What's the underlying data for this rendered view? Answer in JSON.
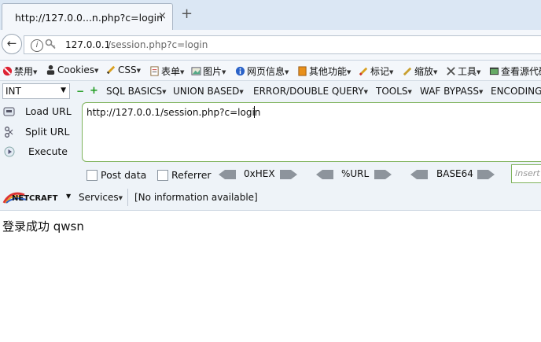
{
  "tab": {
    "title": "http://127.0.0...n.php?c=login",
    "close_glyph": "×",
    "new_tab_glyph": "+"
  },
  "navbar": {
    "url_host": "127.0.0.1",
    "url_path": "/session.php?c=login"
  },
  "toolbar": {
    "items": [
      {
        "label": "禁用",
        "icon": "no-entry-icon"
      },
      {
        "label": "Cookies",
        "icon": "cookie-person-icon"
      },
      {
        "label": "CSS",
        "icon": "pencil-icon"
      },
      {
        "label": "表单",
        "icon": "form-icon"
      },
      {
        "label": "图片",
        "icon": "image-icon"
      },
      {
        "label": "网页信息",
        "icon": "info-icon"
      },
      {
        "label": "其他功能",
        "icon": "orange-box-icon"
      },
      {
        "label": "标记",
        "icon": "highlighter-icon"
      },
      {
        "label": "缩放",
        "icon": "resize-icon"
      },
      {
        "label": "工具",
        "icon": "wrench-icon"
      },
      {
        "label": "查看源代码",
        "icon": "source-icon"
      }
    ]
  },
  "hackbar": {
    "select_value": "INT",
    "menus": [
      "SQL BASICS",
      "UNION BASED",
      "ERROR/DOUBLE QUERY",
      "TOOLS",
      "WAF BYPASS",
      "ENCODING"
    ],
    "load_url": "Load URL",
    "split_url": "Split URL",
    "execute": "Execute",
    "url_text": "http://127.0.0.1/session.php?c=login",
    "post_data": "Post data",
    "referrer": "Referrer",
    "hex": "0xHEX",
    "url_enc": "%URL",
    "base64": "BASE64",
    "insert_placeholder": "Insert",
    "netcraft": "NETCRAFT",
    "services": "Services",
    "info": "[No information available]"
  },
  "content": {
    "text": "登录成功 qwsn"
  }
}
